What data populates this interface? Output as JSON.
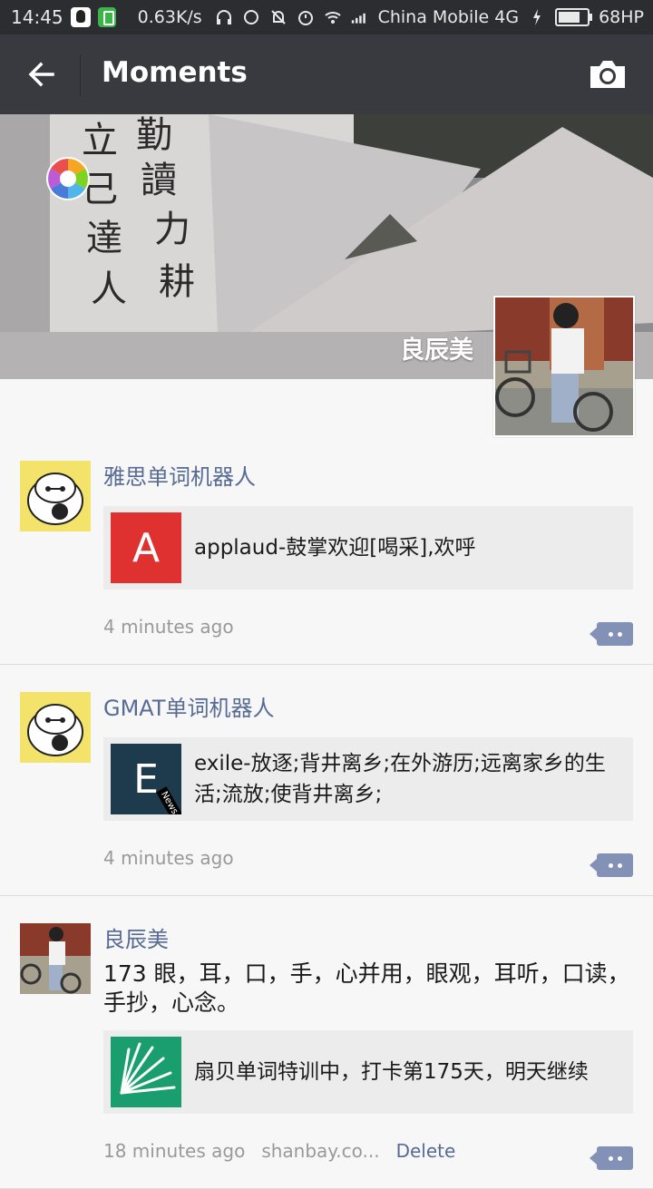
{
  "statusbar": {
    "time": "14:45",
    "speed": "0.63K/s",
    "carrier": "China Mobile 4G",
    "battery": "68HP"
  },
  "header": {
    "title": "Moments",
    "back_icon": "arrow-left-icon",
    "camera_icon": "camera-icon"
  },
  "cover": {
    "username": "良辰美"
  },
  "posts": [
    {
      "nick": "雅思单词机器人",
      "share": {
        "thumb_letter": "A",
        "thumb_color": "#e03131",
        "text": "applaud-鼓掌欢迎[喝采],欢呼"
      },
      "time": "4 minutes ago"
    },
    {
      "nick": "GMAT单词机器人",
      "share": {
        "thumb_letter": "E",
        "thumb_color": "#1d3b4d",
        "thumb_badge": "News",
        "text": "exile-放逐;背井离乡;在外游历;远离家乡的生活;流放;使背井离乡;"
      },
      "time": "4 minutes ago"
    },
    {
      "nick": "良辰美",
      "text": "173 眼，耳，口，手，心并用，眼观，耳听，口读，手抄，心念。",
      "share": {
        "thumb_color": "#1a9e6f",
        "text": "扇贝单词特训中，打卡第175天，明天继续"
      },
      "time": "18 minutes ago",
      "source": "shanbay.co...",
      "delete_label": "Delete"
    }
  ]
}
